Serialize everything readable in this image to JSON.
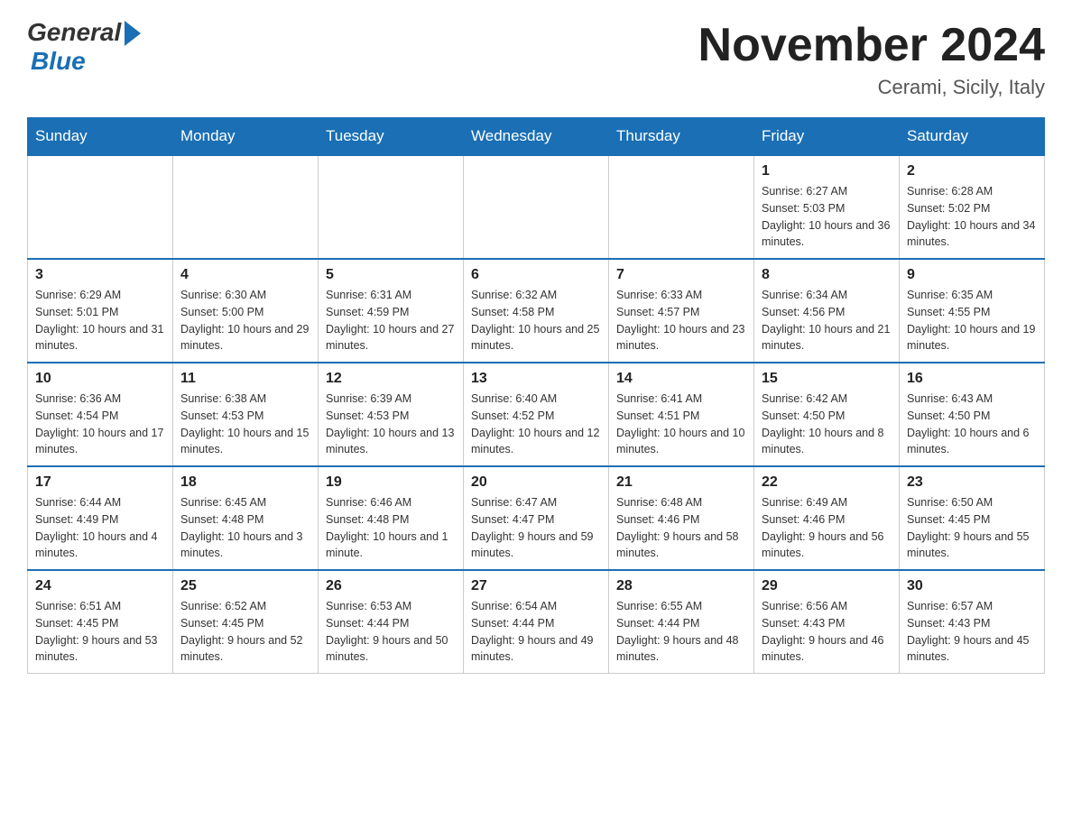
{
  "logo": {
    "general": "General",
    "blue": "Blue"
  },
  "header": {
    "month": "November 2024",
    "location": "Cerami, Sicily, Italy"
  },
  "weekdays": [
    "Sunday",
    "Monday",
    "Tuesday",
    "Wednesday",
    "Thursday",
    "Friday",
    "Saturday"
  ],
  "weeks": [
    [
      {
        "day": "",
        "info": ""
      },
      {
        "day": "",
        "info": ""
      },
      {
        "day": "",
        "info": ""
      },
      {
        "day": "",
        "info": ""
      },
      {
        "day": "",
        "info": ""
      },
      {
        "day": "1",
        "info": "Sunrise: 6:27 AM\nSunset: 5:03 PM\nDaylight: 10 hours and 36 minutes."
      },
      {
        "day": "2",
        "info": "Sunrise: 6:28 AM\nSunset: 5:02 PM\nDaylight: 10 hours and 34 minutes."
      }
    ],
    [
      {
        "day": "3",
        "info": "Sunrise: 6:29 AM\nSunset: 5:01 PM\nDaylight: 10 hours and 31 minutes."
      },
      {
        "day": "4",
        "info": "Sunrise: 6:30 AM\nSunset: 5:00 PM\nDaylight: 10 hours and 29 minutes."
      },
      {
        "day": "5",
        "info": "Sunrise: 6:31 AM\nSunset: 4:59 PM\nDaylight: 10 hours and 27 minutes."
      },
      {
        "day": "6",
        "info": "Sunrise: 6:32 AM\nSunset: 4:58 PM\nDaylight: 10 hours and 25 minutes."
      },
      {
        "day": "7",
        "info": "Sunrise: 6:33 AM\nSunset: 4:57 PM\nDaylight: 10 hours and 23 minutes."
      },
      {
        "day": "8",
        "info": "Sunrise: 6:34 AM\nSunset: 4:56 PM\nDaylight: 10 hours and 21 minutes."
      },
      {
        "day": "9",
        "info": "Sunrise: 6:35 AM\nSunset: 4:55 PM\nDaylight: 10 hours and 19 minutes."
      }
    ],
    [
      {
        "day": "10",
        "info": "Sunrise: 6:36 AM\nSunset: 4:54 PM\nDaylight: 10 hours and 17 minutes."
      },
      {
        "day": "11",
        "info": "Sunrise: 6:38 AM\nSunset: 4:53 PM\nDaylight: 10 hours and 15 minutes."
      },
      {
        "day": "12",
        "info": "Sunrise: 6:39 AM\nSunset: 4:53 PM\nDaylight: 10 hours and 13 minutes."
      },
      {
        "day": "13",
        "info": "Sunrise: 6:40 AM\nSunset: 4:52 PM\nDaylight: 10 hours and 12 minutes."
      },
      {
        "day": "14",
        "info": "Sunrise: 6:41 AM\nSunset: 4:51 PM\nDaylight: 10 hours and 10 minutes."
      },
      {
        "day": "15",
        "info": "Sunrise: 6:42 AM\nSunset: 4:50 PM\nDaylight: 10 hours and 8 minutes."
      },
      {
        "day": "16",
        "info": "Sunrise: 6:43 AM\nSunset: 4:50 PM\nDaylight: 10 hours and 6 minutes."
      }
    ],
    [
      {
        "day": "17",
        "info": "Sunrise: 6:44 AM\nSunset: 4:49 PM\nDaylight: 10 hours and 4 minutes."
      },
      {
        "day": "18",
        "info": "Sunrise: 6:45 AM\nSunset: 4:48 PM\nDaylight: 10 hours and 3 minutes."
      },
      {
        "day": "19",
        "info": "Sunrise: 6:46 AM\nSunset: 4:48 PM\nDaylight: 10 hours and 1 minute."
      },
      {
        "day": "20",
        "info": "Sunrise: 6:47 AM\nSunset: 4:47 PM\nDaylight: 9 hours and 59 minutes."
      },
      {
        "day": "21",
        "info": "Sunrise: 6:48 AM\nSunset: 4:46 PM\nDaylight: 9 hours and 58 minutes."
      },
      {
        "day": "22",
        "info": "Sunrise: 6:49 AM\nSunset: 4:46 PM\nDaylight: 9 hours and 56 minutes."
      },
      {
        "day": "23",
        "info": "Sunrise: 6:50 AM\nSunset: 4:45 PM\nDaylight: 9 hours and 55 minutes."
      }
    ],
    [
      {
        "day": "24",
        "info": "Sunrise: 6:51 AM\nSunset: 4:45 PM\nDaylight: 9 hours and 53 minutes."
      },
      {
        "day": "25",
        "info": "Sunrise: 6:52 AM\nSunset: 4:45 PM\nDaylight: 9 hours and 52 minutes."
      },
      {
        "day": "26",
        "info": "Sunrise: 6:53 AM\nSunset: 4:44 PM\nDaylight: 9 hours and 50 minutes."
      },
      {
        "day": "27",
        "info": "Sunrise: 6:54 AM\nSunset: 4:44 PM\nDaylight: 9 hours and 49 minutes."
      },
      {
        "day": "28",
        "info": "Sunrise: 6:55 AM\nSunset: 4:44 PM\nDaylight: 9 hours and 48 minutes."
      },
      {
        "day": "29",
        "info": "Sunrise: 6:56 AM\nSunset: 4:43 PM\nDaylight: 9 hours and 46 minutes."
      },
      {
        "day": "30",
        "info": "Sunrise: 6:57 AM\nSunset: 4:43 PM\nDaylight: 9 hours and 45 minutes."
      }
    ]
  ]
}
